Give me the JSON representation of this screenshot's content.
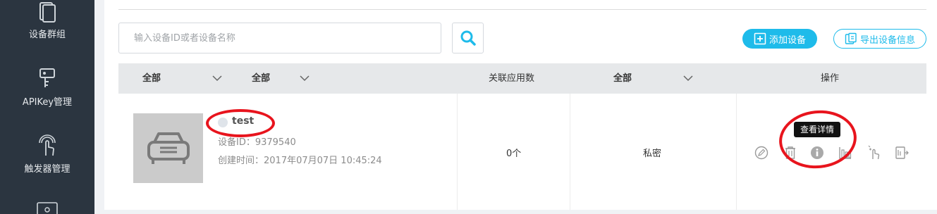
{
  "sidebar": {
    "items": [
      {
        "label": "设备群组",
        "icon": "device-group-icon"
      },
      {
        "label": "APIKey管理",
        "icon": "apikey-icon"
      },
      {
        "label": "触发器管理",
        "icon": "trigger-icon"
      },
      {
        "label": "",
        "icon": "settings-icon"
      }
    ]
  },
  "search": {
    "placeholder": "输入设备ID或者设备名称",
    "value": ""
  },
  "toolbar": {
    "add_label": "添加设备",
    "export_label": "导出设备信息"
  },
  "table": {
    "headers": {
      "col1_filter": "全部",
      "col2_filter": "全部",
      "app_count": "关联应用数",
      "col4_filter": "全部",
      "actions": "操作"
    },
    "rows": [
      {
        "name": "test",
        "id_text": "设备ID：9379540",
        "created_text": "创建时间：2017年07月07日 10:45:24",
        "app_count": "0个",
        "privacy": "私密"
      }
    ],
    "tooltip": "查看详情"
  },
  "colors": {
    "accent": "#1ebbea",
    "sidebar": "#2b3540",
    "annotation": "#e8141d"
  }
}
